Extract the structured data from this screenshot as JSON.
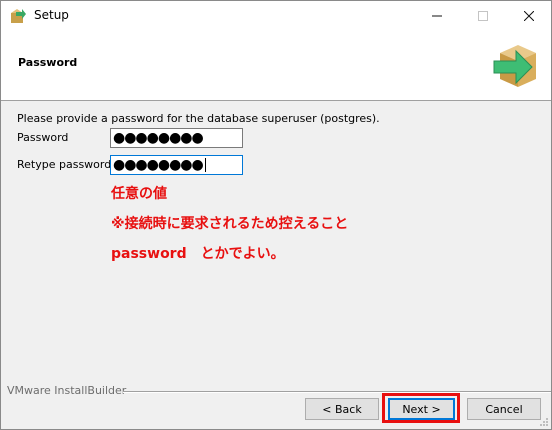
{
  "window": {
    "title": "Setup",
    "controls": {
      "minimize": "—",
      "maximize": "☐",
      "close": "✕"
    }
  },
  "header": {
    "title": "Password",
    "icon": "installer-box-arrow-icon"
  },
  "content": {
    "intro": "Please provide a password for the database superuser (postgres).",
    "password_label": "Password",
    "password_value": "●●●●●●●●",
    "retype_label": "Retype password",
    "retype_value": "●●●●●●●●"
  },
  "annotations": {
    "line1": "任意の値",
    "line2": "※接続時に要求されるため控えること",
    "line3": "password　とかでよい。",
    "color": "#e81010"
  },
  "footer": {
    "brand": "VMware InstallBuilder",
    "back_label": "< Back",
    "next_label": "Next >",
    "cancel_label": "Cancel"
  }
}
